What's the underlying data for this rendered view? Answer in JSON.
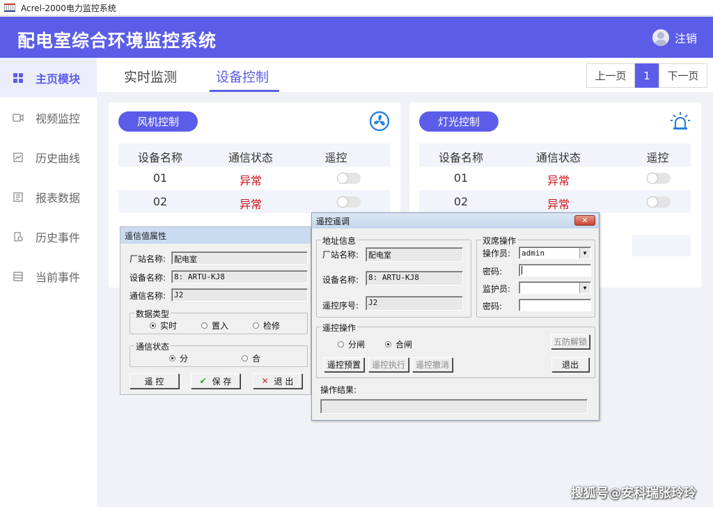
{
  "window": {
    "title": "Acrel-2000电力监控系统"
  },
  "header": {
    "title": "配电室综合环境监控系统",
    "logout": "注销"
  },
  "sidebar": {
    "items": [
      {
        "label": "主页模块",
        "icon": "grid-icon",
        "active": true
      },
      {
        "label": "视频监控",
        "icon": "video-icon"
      },
      {
        "label": "历史曲线",
        "icon": "chart-icon"
      },
      {
        "label": "报表数据",
        "icon": "report-icon"
      },
      {
        "label": "历史事件",
        "icon": "history-icon"
      },
      {
        "label": "当前事件",
        "icon": "list-icon"
      }
    ]
  },
  "tabs": [
    {
      "label": "实时监测"
    },
    {
      "label": "设备控制",
      "active": true
    }
  ],
  "pager": {
    "prev": "上一页",
    "current": "1",
    "next": "下一页"
  },
  "fan_card": {
    "title": "风机控制",
    "icon": "fan-icon",
    "columns": [
      "设备名称",
      "通信状态",
      "遥控"
    ],
    "rows": [
      {
        "name": "01",
        "status": "异常"
      },
      {
        "name": "02",
        "status": "异常"
      }
    ]
  },
  "light_card": {
    "title": "灯光控制",
    "icon": "alarm-light-icon",
    "columns": [
      "设备名称",
      "通信状态",
      "遥控"
    ],
    "rows": [
      {
        "name": "01",
        "status": "异常"
      },
      {
        "name": "02",
        "status": "异常"
      }
    ]
  },
  "dialog_signal": {
    "title": "遥信值属性",
    "station_label": "厂站名称:",
    "station_value": "配电室",
    "device_label": "设备名称:",
    "device_value": "8: ARTU-KJ8",
    "comm_label": "通信名称:",
    "comm_value": "J2",
    "data_type_title": "数据类型",
    "data_types": [
      "实时",
      "置入",
      "检修"
    ],
    "comm_status_title": "通信状态",
    "comm_status_options": [
      "分",
      "合"
    ],
    "btn_remote": "遥 控",
    "btn_save": "保 存",
    "btn_exit": "退 出"
  },
  "dialog_remote": {
    "title": "遥控遥调",
    "addr_title": "地址信息",
    "station_label": "厂站名称:",
    "station_value": "配电室",
    "device_label": "设备名称:",
    "device_value": "8: ARTU-KJ8",
    "seq_label": "遥控序号:",
    "seq_value": "J2",
    "dual_title": "双席操作",
    "operator_label": "操作员:",
    "operator_value": "admin",
    "pwd_label": "密码:",
    "supervisor_label": "监护员:",
    "pwd2_label": "密码:",
    "op_title": "遥控操作",
    "op_options": [
      "分闸",
      "合闸"
    ],
    "btn_unlock": "五防解锁",
    "btn_preset": "遥控预置",
    "btn_execute": "遥控执行",
    "btn_cancel": "遥控撤消",
    "btn_exit": "退出",
    "result_label": "操作结果:",
    "close": "✕"
  },
  "watermark": "搜狐号@安科瑞张玲玲"
}
